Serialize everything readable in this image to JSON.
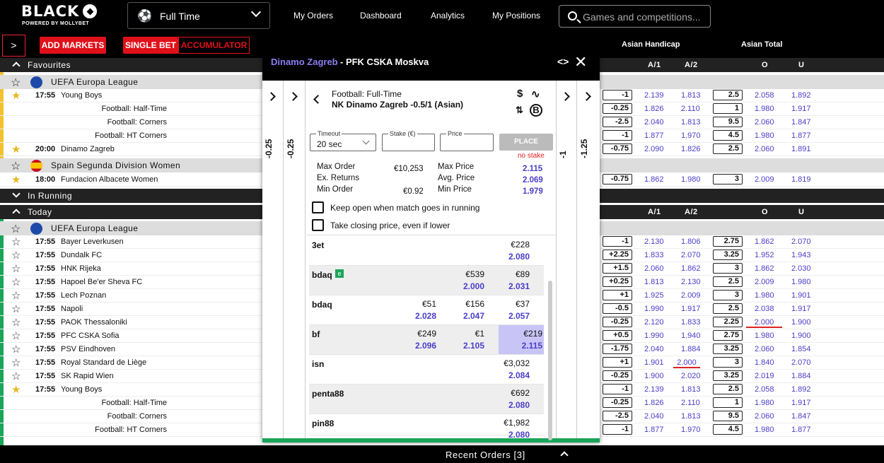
{
  "header": {
    "logo_word": "BLACK",
    "logo_sub": "POWERED BY MOLLYBET",
    "market_select": "Full Time",
    "nav": [
      "My Orders",
      "Dashboard",
      "Analytics",
      "My Positions"
    ],
    "search_placeholder": "Games and competitions..."
  },
  "toolbar": {
    "expand": ">",
    "add_markets": "ADD MARKETS",
    "single_bet": "SINGLE BET",
    "accumulator": "ACCUMULATOR",
    "asian_handicap": "Asian Handicap",
    "asian_total": "Asian Total",
    "cols": [
      "A/1",
      "A/2",
      "O",
      "U"
    ]
  },
  "sections": {
    "favourites": "Favourites",
    "in_running": "In Running",
    "today": "Today"
  },
  "leagues": {
    "uefa": "UEFA Europa League",
    "spain": "Spain Segunda Division Women",
    "uefa2": "UEFA Europa League"
  },
  "fav_rows": [
    {
      "time": "17:55",
      "name": "Young Boys",
      "market": "",
      "hc": "-1",
      "a1": "2.139",
      "a2": "1.813",
      "tot": "2.5",
      "o": "2.058",
      "u": "1.892"
    },
    {
      "time": "",
      "name": "",
      "market": "Football: Half-Time",
      "hc": "-0.25",
      "a1": "1.826",
      "a2": "2.110",
      "tot": "1",
      "o": "1.980",
      "u": "1.917"
    },
    {
      "time": "",
      "name": "",
      "market": "Football: Corners",
      "hc": "-2.5",
      "a1": "2.040",
      "a2": "1.813",
      "tot": "9.5",
      "o": "2.060",
      "u": "1.847"
    },
    {
      "time": "",
      "name": "",
      "market": "Football: HT Corners",
      "hc": "-1",
      "a1": "1.877",
      "a2": "1.970",
      "tot": "4.5",
      "o": "1.980",
      "u": "1.877"
    },
    {
      "time": "20:00",
      "name": "Dinamo Zagreb",
      "market": "",
      "hc": "-0.75",
      "a1": "2.090",
      "a2": "1.826",
      "tot": "2.5",
      "o": "2.060",
      "u": "1.891"
    }
  ],
  "spain_rows": [
    {
      "time": "18:00",
      "name": "Fundacion Albacete Women",
      "market": "",
      "hc": "-0.75",
      "a1": "1.862",
      "a2": "1.980",
      "tot": "3",
      "o": "2.009",
      "u": "1.819"
    }
  ],
  "today_rows": [
    {
      "time": "17:55",
      "name": "Bayer Leverkusen",
      "market": "",
      "hc": "-1",
      "a1": "2.130",
      "a2": "1.806",
      "tot": "2.75",
      "o": "1.862",
      "u": "2.070"
    },
    {
      "time": "17:55",
      "name": "Dundalk FC",
      "market": "",
      "hc": "+2.25",
      "a1": "1.833",
      "a2": "2.070",
      "tot": "3.25",
      "o": "1.952",
      "u": "1.943"
    },
    {
      "time": "17:55",
      "name": "HNK Rijeka",
      "market": "",
      "hc": "+1.5",
      "a1": "2.060",
      "a2": "1.862",
      "tot": "3",
      "o": "1.862",
      "u": "2.030"
    },
    {
      "time": "17:55",
      "name": "Hapoel Be'er Sheva FC",
      "market": "",
      "hc": "+0.25",
      "a1": "1.813",
      "a2": "2.130",
      "tot": "2.5",
      "o": "2.009",
      "u": "1.980"
    },
    {
      "time": "17:55",
      "name": "Lech Poznan",
      "market": "",
      "hc": "+1",
      "a1": "1.925",
      "a2": "2.009",
      "tot": "3",
      "o": "1.980",
      "u": "1.901"
    },
    {
      "time": "17:55",
      "name": "Napoli",
      "market": "",
      "hc": "-0.5",
      "a1": "1.990",
      "a2": "1.917",
      "tot": "2.5",
      "o": "2.038",
      "u": "1.917"
    },
    {
      "time": "17:55",
      "name": "PAOK Thessaloniki",
      "market": "",
      "hc": "-0.25",
      "a1": "2.120",
      "a2": "1.833",
      "tot": "2.25",
      "o": "2.000",
      "u": "1.900"
    },
    {
      "time": "17:55",
      "name": "PFC CSKA Sofia",
      "market": "",
      "hc": "+0.5",
      "a1": "1.990",
      "a2": "1.940",
      "tot": "2.75",
      "o": "1.980",
      "u": "1.900"
    },
    {
      "time": "17:55",
      "name": "PSV Eindhoven",
      "market": "",
      "hc": "-1.75",
      "a1": "2.040",
      "a2": "1.884",
      "tot": "3.25",
      "o": "2.060",
      "u": "1.854"
    },
    {
      "time": "17:55",
      "name": "Royal Standard de Liège",
      "market": "",
      "hc": "+1",
      "a1": "1.901",
      "a2": "2.000",
      "tot": "3",
      "o": "1.840",
      "u": "2.070"
    },
    {
      "time": "17:55",
      "name": "SK Rapid Wien",
      "market": "",
      "hc": "-0.25",
      "a1": "1.900",
      "a2": "2.020",
      "tot": "3.25",
      "o": "2.019",
      "u": "1.884"
    },
    {
      "time": "17:55",
      "name": "Young Boys",
      "market": "",
      "hc": "-1",
      "a1": "2.139",
      "a2": "1.813",
      "tot": "2.5",
      "o": "2.058",
      "u": "1.892"
    },
    {
      "time": "",
      "name": "",
      "market": "Football: Half-Time",
      "hc": "-0.25",
      "a1": "1.826",
      "a2": "2.110",
      "tot": "1",
      "o": "1.980",
      "u": "1.917"
    },
    {
      "time": "",
      "name": "",
      "market": "Football: Corners",
      "hc": "-2.5",
      "a1": "2.040",
      "a2": "1.813",
      "tot": "9.5",
      "o": "2.060",
      "u": "1.847"
    },
    {
      "time": "",
      "name": "",
      "market": "Football: HT Corners",
      "hc": "-1",
      "a1": "1.877",
      "a2": "1.970",
      "tot": "4.5",
      "o": "1.980",
      "u": "1.877"
    }
  ],
  "popup": {
    "home": "Dinamo Zagreb",
    "away": "-  PFK CSKA Moskva",
    "code_icon": "<>",
    "close": "✕",
    "left_outer": "-0.25",
    "left_inner": "-0.25",
    "right_inner": "-1",
    "right_outer": "-1.25",
    "market_line1": "Football: Full-Time",
    "market_line2": "NK Dinamo Zagreb -0.5/1 (Asian)",
    "timeout_label": "Timeout",
    "timeout_value": "20 sec",
    "stake_label": "Stake (€)",
    "price_label": "Price",
    "place": "PLACE",
    "no_stake": "no stake",
    "max_order_l": "Max Order",
    "max_order_v": "€10,253",
    "ex_returns_l": "Ex. Returns",
    "min_order_l": "Min Order",
    "min_order_v": "€0.92",
    "max_price_l": "Max Price",
    "max_price_v": "2.115",
    "avg_price_l": "Avg. Price",
    "avg_price_v": "2.069",
    "min_price_l": "Min Price",
    "min_price_v": "1.979",
    "keep_open": "Keep open when match goes in running",
    "closing_price": "Take closing price, even if lower",
    "books": [
      {
        "name": "3et",
        "c1": "",
        "p1": "",
        "c2": "",
        "p2": "",
        "c3": "€228",
        "p3": "2.080"
      },
      {
        "name": "bdaq",
        "c1": "",
        "p1": "",
        "c2": "€539",
        "p2": "2.000",
        "c3": "€89",
        "p3": "2.031"
      },
      {
        "name": "bdaq",
        "c1": "€51",
        "p1": "2.028",
        "c2": "€156",
        "p2": "2.047",
        "c3": "€37",
        "p3": "2.057"
      },
      {
        "name": "bf",
        "c1": "€249",
        "p1": "2.096",
        "c2": "€1",
        "p2": "2.105",
        "c3": "€219",
        "p3": "2.115"
      },
      {
        "name": "isn",
        "c1": "",
        "p1": "",
        "c2": "",
        "p2": "",
        "c3": "€3,032",
        "p3": "2.084"
      },
      {
        "name": "penta88",
        "c1": "",
        "p1": "",
        "c2": "",
        "p2": "",
        "c3": "€692",
        "p3": "2.080"
      },
      {
        "name": "pin88",
        "c1": "",
        "p1": "",
        "c2": "",
        "p2": "",
        "c3": "€1,982",
        "p3": "2.080"
      }
    ],
    "bdaq_badge": "e"
  },
  "footer": {
    "recent_orders": "Recent Orders    [3]"
  }
}
